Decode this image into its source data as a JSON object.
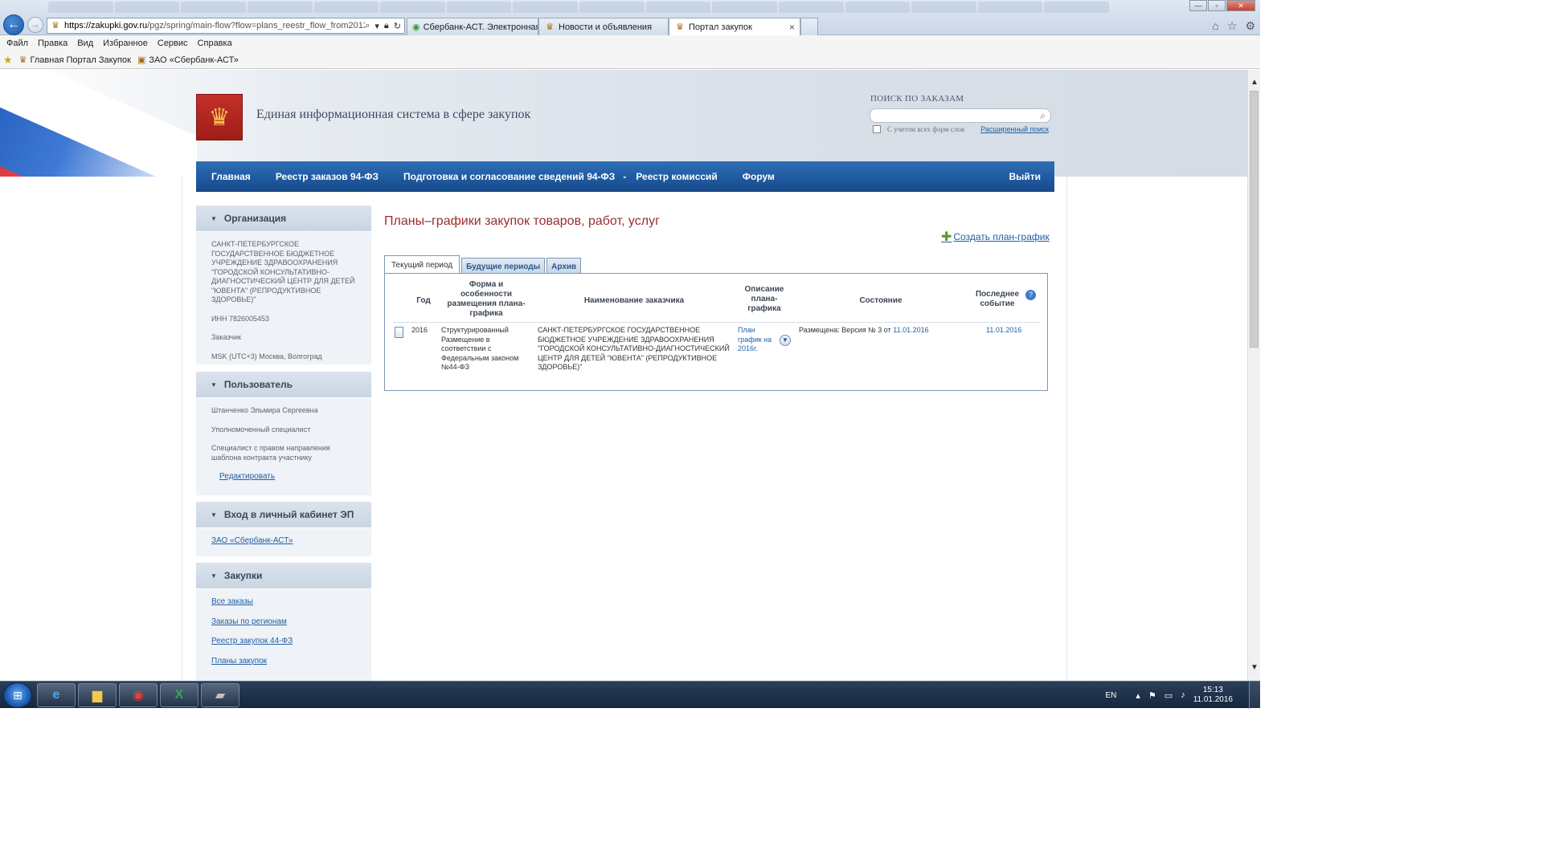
{
  "browser": {
    "url_host": "https://zakupki.gov.ru",
    "url_path": "/pgz/spring/main-flow?flow=plans_reestr_flow_from2013",
    "tabs": [
      {
        "label": "Сбербанк-АСТ. Электронная ...",
        "active": false
      },
      {
        "label": "Новости и объявления",
        "active": false
      },
      {
        "label": "Портал закупок",
        "active": true
      }
    ],
    "tab_close": "×",
    "menu": [
      "Файл",
      "Правка",
      "Вид",
      "Избранное",
      "Сервис",
      "Справка"
    ],
    "favorites": [
      "Главная Портал Закупок",
      "ЗАО «Сбербанк-АСТ»"
    ]
  },
  "header": {
    "site_title": "Единая информационная система в сфере закупок",
    "search_label": "ПОИСК ПО ЗАКАЗАМ",
    "search_value": "",
    "search_all_forms": "С учетом всех форм слов",
    "advanced_search": "Расширенный поиск"
  },
  "nav": {
    "items": [
      "Главная",
      "Реестр заказов 94-ФЗ",
      "Подготовка и согласование сведений 94-ФЗ",
      "-",
      "Реестр комиссий",
      "Форум"
    ],
    "logout": "Выйти"
  },
  "sidebar": {
    "organization": {
      "title": "Организация",
      "name": "САНКТ-ПЕТЕРБУРГСКОЕ ГОСУДАРСТВЕННОЕ БЮДЖЕТНОЕ УЧРЕЖДЕНИЕ ЗДРАВООХРАНЕНИЯ \"ГОРОДСКОЙ КОНСУЛЬТАТИВНО-ДИАГНОСТИЧЕСКИЙ ЦЕНТР ДЛЯ ДЕТЕЙ \"ЮВЕНТА\" (РЕПРОДУКТИВНОЕ ЗДОРОВЬЕ)\"",
      "inn": "ИНН 7826005453",
      "role": "Заказчик",
      "timezone": "MSK (UTC+3) Москва, Волгоград"
    },
    "user": {
      "title": "Пользователь",
      "name": "Штанченко Эльмира Сергеевна",
      "role1": "Уполномоченный специалист",
      "role2": "Специалист с правом направления шаблона контракта участнику",
      "edit": "Редактировать"
    },
    "cabinet": {
      "title": "Вход в личный кабинет ЭП",
      "link": "ЗАО «Сбербанк-АСТ»"
    },
    "purchases": {
      "title": "Закупки",
      "links": [
        "Все заказы",
        "Заказы по регионам",
        "Реестр закупок 44-ФЗ",
        "Планы закупок"
      ]
    }
  },
  "main": {
    "heading": "Планы–графики закупок товаров, работ, услуг",
    "create_link": "Создать план-график",
    "tabs": [
      "Текущий период",
      "Будущие периоды",
      "Архив"
    ],
    "columns": {
      "year": "Год",
      "form": "Форма и особенности размещения плана-графика",
      "customer": "Наименование заказчика",
      "description": "Описание плана-графика",
      "status": "Состояние",
      "last_event": "Последнее событие"
    },
    "rows": [
      {
        "year": "2016",
        "form": "Структурированный Размещение в соответствии с Федеральным законом №44-ФЗ",
        "customer": "САНКТ-ПЕТЕРБУРГСКОЕ ГОСУДАРСТВЕННОЕ БЮДЖЕТНОЕ УЧРЕЖДЕНИЕ ЗДРАВООХРАНЕНИЯ \"ГОРОДСКОЙ КОНСУЛЬТАТИВНО-ДИАГНОСТИЧЕСКИЙ ЦЕНТР ДЛЯ ДЕТЕЙ \"ЮВЕНТА\" (РЕПРОДУКТИВНОЕ ЗДОРОВЬЕ)\"",
        "description": "План график на 2016г.",
        "status_prefix": "Размещена: Версия № 3 от ",
        "status_date": "11.01.2016",
        "last_event": "11.01.2016"
      }
    ]
  },
  "taskbar": {
    "lang": "EN",
    "time": "15:13",
    "date": "11.01.2016"
  }
}
